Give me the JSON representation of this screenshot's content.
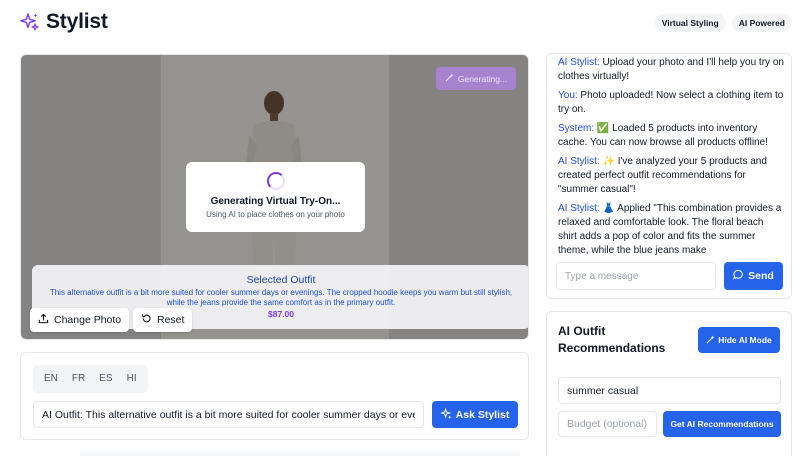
{
  "header": {
    "title": "Stylist",
    "badges": [
      "Virtual Styling",
      "AI Powered"
    ],
    "accent_color": "#7c3aed"
  },
  "preview": {
    "generating_label": "Generating...",
    "loading_title": "Generating Virtual Try-On...",
    "loading_subtitle": "Using AI to place clothes on your photo",
    "selected_title": "Selected Outfit",
    "selected_description": "This alternative outfit is a bit more suited for cooler summer days or evenings. The cropped hoodie keeps you warm but still stylish, while the jeans provide the same comfort as in the primary outfit.",
    "selected_price": "$87.00",
    "change_photo_label": "Change Photo",
    "reset_label": "Reset"
  },
  "input_panel": {
    "languages": [
      "EN",
      "FR",
      "ES",
      "HI"
    ],
    "prompt_value": "AI Outfit: This alternative outfit is a bit more suited for cooler summer days or evenings.",
    "ask_label": "Ask Stylist"
  },
  "chat": {
    "messages": [
      {
        "sender": "AI Stylist:",
        "text": " Upload your photo and I'll help you try on clothes virtually!"
      },
      {
        "sender": "You:",
        "text": " Photo uploaded! Now select a clothing item to try on."
      },
      {
        "sender": "System:",
        "text": " ✅ Loaded 5 products into inventory cache. You can now browse all products offline!"
      },
      {
        "sender": "AI Stylist:",
        "text": " ✨ I've analyzed your 5 products and created perfect outfit recommendations for \"summer casual\"!"
      },
      {
        "sender": "AI Stylist:",
        "text": " 👗 Applied \"This combination provides a relaxed and comfortable look. The floral beach shirt adds a pop of color and fits the summer theme, while the blue jeans make"
      }
    ],
    "input_placeholder": "Type a message",
    "send_label": "Send"
  },
  "recommendations": {
    "title": "AI Outfit Recommendations",
    "hide_label": "Hide AI Mode",
    "style_value": "summer casual",
    "budget_placeholder": "Budget (optional)",
    "get_label": "Get AI Recommendations"
  }
}
